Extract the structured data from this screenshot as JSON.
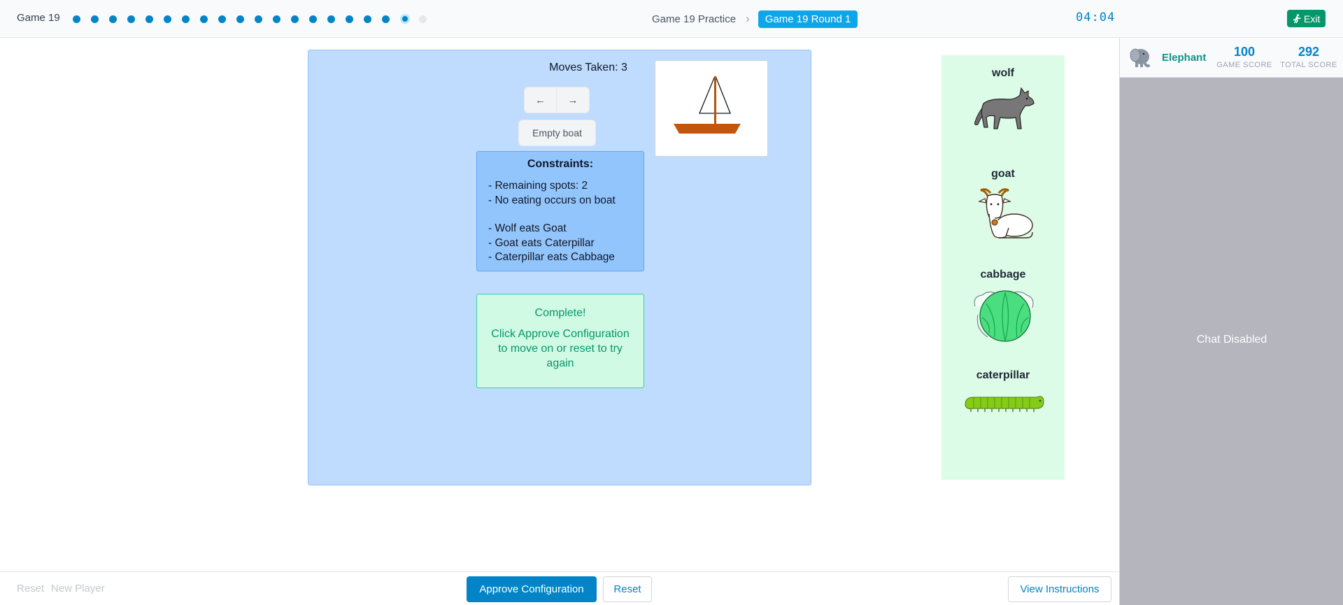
{
  "header": {
    "game_label": "Game 19",
    "progress": {
      "total_steps": 20,
      "completed_steps": 18,
      "current_step": 19
    },
    "breadcrumb": {
      "parent": "Game 19 Practice",
      "separator": "›",
      "current": "Game 19 Round 1"
    },
    "timer": "04:04",
    "exit_label": "Exit"
  },
  "board": {
    "moves_label": "Moves Taken: 3",
    "nav_left_icon": "←",
    "nav_right_icon": "→",
    "empty_boat_label": "Empty boat",
    "constraints": {
      "title": "Constraints:",
      "rules_a": [
        "- Remaining spots: 2",
        "- No eating occurs on boat"
      ],
      "rules_b": [
        "- Wolf eats Goat",
        "- Goat eats Caterpillar",
        "- Caterpillar eats Cabbage"
      ]
    },
    "complete": {
      "heading": "Complete!",
      "message": "Click Approve Configuration to move on or reset to try again"
    }
  },
  "bank": {
    "items": [
      {
        "name": "wolf",
        "icon": "wolf-icon"
      },
      {
        "name": "goat",
        "icon": "goat-icon"
      },
      {
        "name": "cabbage",
        "icon": "cabbage-icon"
      },
      {
        "name": "caterpillar",
        "icon": "caterpillar-icon"
      }
    ]
  },
  "side_panel": {
    "player_name": "Elephant",
    "player_icon": "elephant-icon",
    "game_score": "100",
    "game_score_label": "GAME SCORE",
    "total_score": "292",
    "total_score_label": "TOTAL SCORE",
    "chat_status": "Chat Disabled"
  },
  "footer": {
    "reset_link": "Reset",
    "new_player_link": "New Player",
    "approve_label": "Approve Configuration",
    "reset_label": "Reset",
    "instructions_label": "View Instructions"
  },
  "colors": {
    "accent": "#0284c7",
    "board_bg": "#bfdbfe",
    "constraints_bg": "#93c5fd",
    "complete_bg": "#d1fae5",
    "complete_text": "#059669",
    "bank_bg": "#dcfce7",
    "exit_bg": "#059669",
    "side_bg": "#b4b5bd"
  }
}
